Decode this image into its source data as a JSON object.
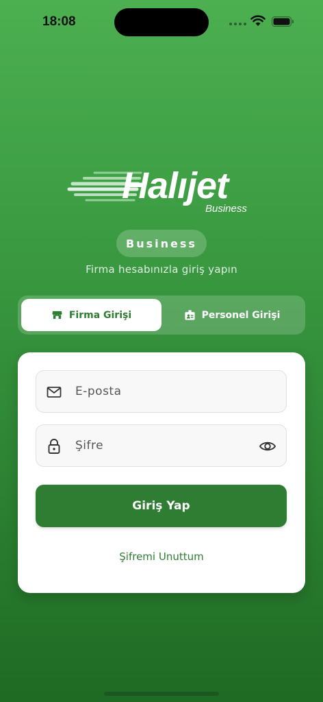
{
  "status_bar": {
    "time": "18:08"
  },
  "logo": {
    "wordmark": "Halıjet",
    "sub": "Business"
  },
  "badge": {
    "label": "Business"
  },
  "subtitle": "Firma hesabınızla giriş yapın",
  "tabs": [
    {
      "label": "Firma Girişi",
      "icon": "store-icon",
      "active": true
    },
    {
      "label": "Personel Girişi",
      "icon": "badge-icon",
      "active": false
    }
  ],
  "form": {
    "email_placeholder": "E-posta",
    "password_placeholder": "Şifre",
    "login_label": "Giriş Yap",
    "forgot_label": "Şifremi Unuttum"
  },
  "colors": {
    "primary": "#2e7d32",
    "background_top": "#4caf50",
    "background_bottom": "#1f6a24"
  }
}
